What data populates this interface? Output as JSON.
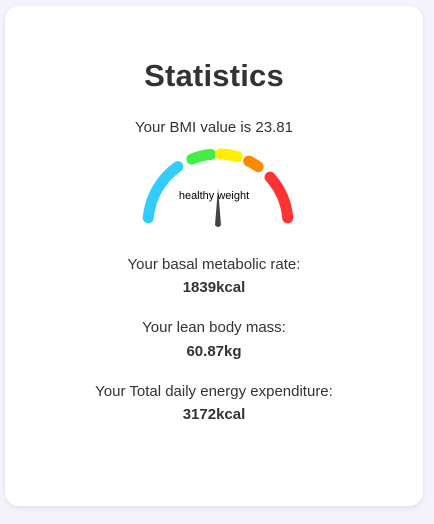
{
  "title": "Statistics",
  "bmi": {
    "prefix": "Your BMI value is",
    "value": "23.81",
    "category": "healthy weight"
  },
  "gauge": {
    "segment_colors": [
      "#33ccff",
      "#44ee44",
      "#ffee00",
      "#ff8800",
      "#ff3333"
    ],
    "needle_color": "#444444",
    "needle_icon": "gauge-needle-icon"
  },
  "stats": [
    {
      "label": "Your basal metabolic rate:",
      "value": "1839kcal"
    },
    {
      "label": "Your lean body mass:",
      "value": "60.87kg"
    },
    {
      "label": "Your Total daily energy expenditure:",
      "value": "3172kcal"
    }
  ]
}
